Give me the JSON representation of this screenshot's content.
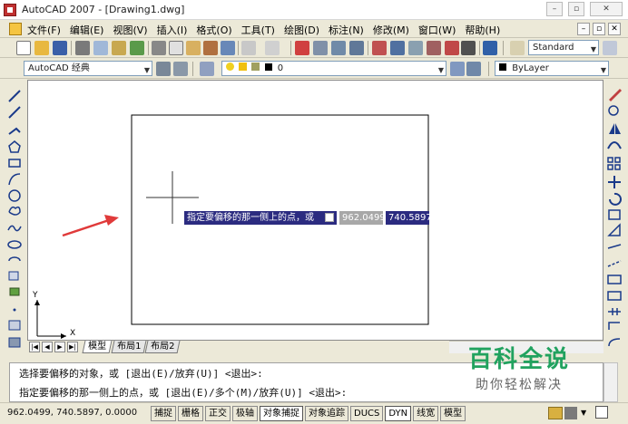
{
  "window": {
    "title": "AutoCAD 2007 - [Drawing1.dwg]"
  },
  "menubar": {
    "items": [
      "文件(F)",
      "编辑(E)",
      "视图(V)",
      "插入(I)",
      "格式(O)",
      "工具(T)",
      "绘图(D)",
      "标注(N)",
      "修改(M)",
      "窗口(W)",
      "帮助(H)"
    ]
  },
  "toolbar": {
    "text_style": "Standard",
    "workspace": "AutoCAD 经典",
    "layer_value": "0",
    "linetype": "ByLayer"
  },
  "layout_tabs": [
    "模型",
    "布局1",
    "布局2"
  ],
  "ucs": {
    "x_label": "X",
    "y_label": "Y"
  },
  "dynamic_input": {
    "prompt": "指定要偏移的那一侧上的点，或",
    "x_value": "962.0499",
    "y_value": "740.5897"
  },
  "command_line": {
    "line1": "选择要偏移的对象，或 [退出(E)/放弃(U)] <退出>:",
    "line2": "指定要偏移的那一侧上的点，或 [退出(E)/多个(M)/放弃(U)] <退出>:"
  },
  "statusbar": {
    "coords": "962.0499,  740.5897, 0.0000",
    "buttons": [
      "捕捉",
      "栅格",
      "正交",
      "极轴",
      "对象捕捉",
      "对象追踪",
      "DUCS",
      "DYN",
      "线宽",
      "模型"
    ]
  },
  "watermark": {
    "line1": "百科全说",
    "line2": "助你轻松解决"
  },
  "colors": {
    "arrow": "#e03a3a",
    "tooltip_bg": "#2b2b80",
    "watermark": "#21a25f"
  }
}
